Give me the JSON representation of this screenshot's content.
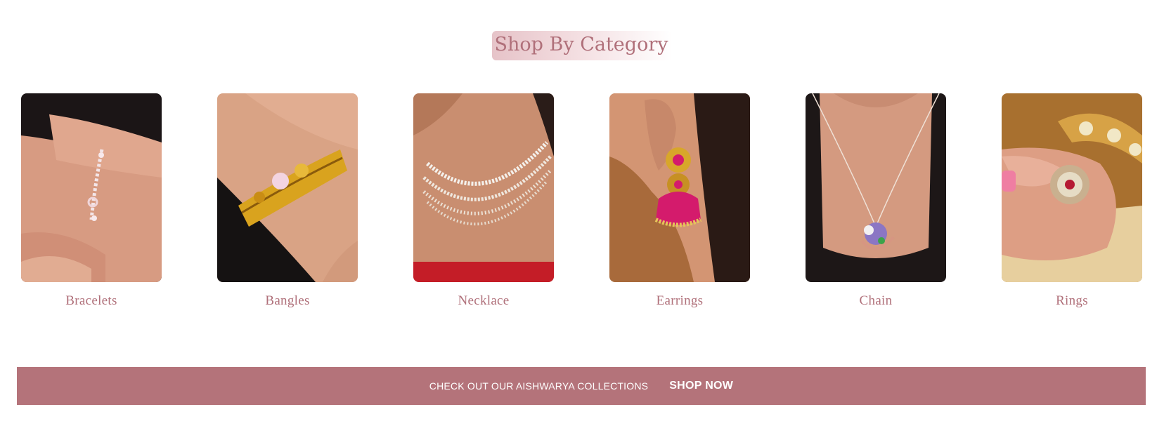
{
  "section": {
    "title": "Shop By Category"
  },
  "categories": [
    {
      "label": "Bracelets",
      "image": "bracelet-on-wrist-photo"
    },
    {
      "label": "Bangles",
      "image": "gold-bangle-on-wrist-photo"
    },
    {
      "label": "Necklace",
      "image": "diamond-necklace-photo"
    },
    {
      "label": "Earrings",
      "image": "jhumka-earring-photo"
    },
    {
      "label": "Chain",
      "image": "pendant-chain-photo"
    },
    {
      "label": "Rings",
      "image": "cocktail-ring-photo"
    }
  ],
  "banner": {
    "text": "CHECK OUT OUR AISHWARYA COLLECTIONS",
    "button": "SHOP NOW"
  },
  "colors": {
    "accent": "#b0707a",
    "banner_bg": "#b4737a"
  }
}
